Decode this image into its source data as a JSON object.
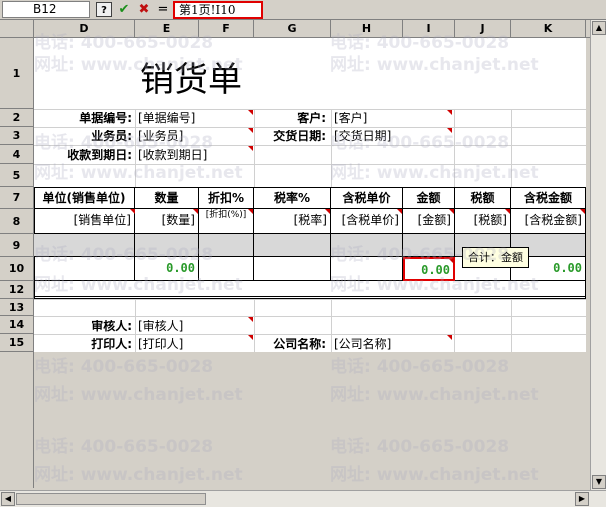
{
  "formula_bar": {
    "name_box": "B12",
    "help": "?",
    "confirm": "✔",
    "cancel": "✖",
    "equals": "=",
    "formula": "第1页!I10"
  },
  "columns": [
    "D",
    "E",
    "F",
    "G",
    "H",
    "I",
    "J",
    "K"
  ],
  "rows": [
    "1",
    "2",
    "3",
    "4",
    "5",
    "7",
    "8",
    "9",
    "10",
    "12",
    "13",
    "14",
    "15"
  ],
  "sheet": {
    "title": "销货单",
    "doc_no_label": "单据编号:",
    "doc_no_value": "[单据编号]",
    "customer_label": "客户:",
    "customer_value": "[客户]",
    "salesman_label": "业务员:",
    "salesman_value": "[业务员]",
    "delivery_label": "交货日期:",
    "delivery_value": "[交货日期]",
    "due_label": "收款到期日:",
    "due_value": "[收款到期日]",
    "headers": [
      "单位(销售单位)",
      "数量",
      "折扣%",
      "税率%",
      "含税单价",
      "金额",
      "税额",
      "含税金额"
    ],
    "fields": [
      "[销售单位]",
      "[数量]",
      "[折扣(%)]",
      "[税率]",
      "[含税单价]",
      "[金额]",
      "[税额]",
      "[含税金额]"
    ],
    "totals": {
      "qty": "0.00",
      "amount": "0.00",
      "tax_total": "0.00"
    },
    "tooltip": "合计：金额",
    "auditor_label": "审核人:",
    "auditor_value": "[审核人]",
    "printer_label": "打印人:",
    "printer_value": "[打印人]",
    "company_label": "公司名称:",
    "company_value": "[公司名称]"
  },
  "watermark": {
    "phone": "电话: 400-665-0028",
    "site": "网址: www.chanjet.net"
  },
  "colors": {
    "accent_red": "#e00000",
    "total_green": "#2a9a2a"
  }
}
